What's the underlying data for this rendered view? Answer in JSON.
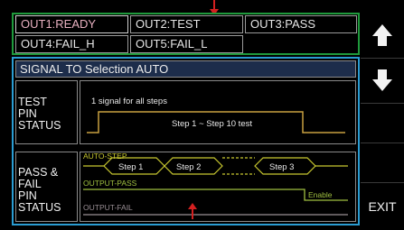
{
  "outputs": [
    {
      "label": "OUT1:READY"
    },
    {
      "label": "OUT2:TEST"
    },
    {
      "label": "OUT3:PASS"
    },
    {
      "label": "OUT4:FAIL_H"
    },
    {
      "label": "OUT5:FAIL_L"
    }
  ],
  "selection_bar": {
    "label": "SIGNAL TO Selection AUTO"
  },
  "test_pin": {
    "label_lines": [
      "TEST",
      "PIN",
      "STATUS"
    ],
    "note": "1 signal for all steps",
    "range_text": "Step 1 ~ Step 10 test"
  },
  "pass_fail": {
    "label_lines": [
      "PASS &",
      "FAIL",
      "PIN",
      "STATUS"
    ],
    "auto_step": "AUTO-STEP",
    "steps": [
      "Step 1",
      "Step 2",
      "Step 3"
    ],
    "output_pass": "OUTPUT-PASS",
    "enable": "Enable",
    "output_fail": "OUTPUT-FAIL"
  },
  "softkeys": {
    "up_icon": "arrow-up-icon",
    "down_icon": "arrow-down-icon",
    "exit_label": "EXIT"
  },
  "colors": {
    "signal_gold": "#c8a040",
    "auto_step_yellow": "#c8c830",
    "pass_green": "#a0c040",
    "fail_gray": "#9a8f95",
    "output_frame_green": "#1f9a3c",
    "panel_frame_blue": "#2a9cd2",
    "annotation_red": "#d42020"
  }
}
